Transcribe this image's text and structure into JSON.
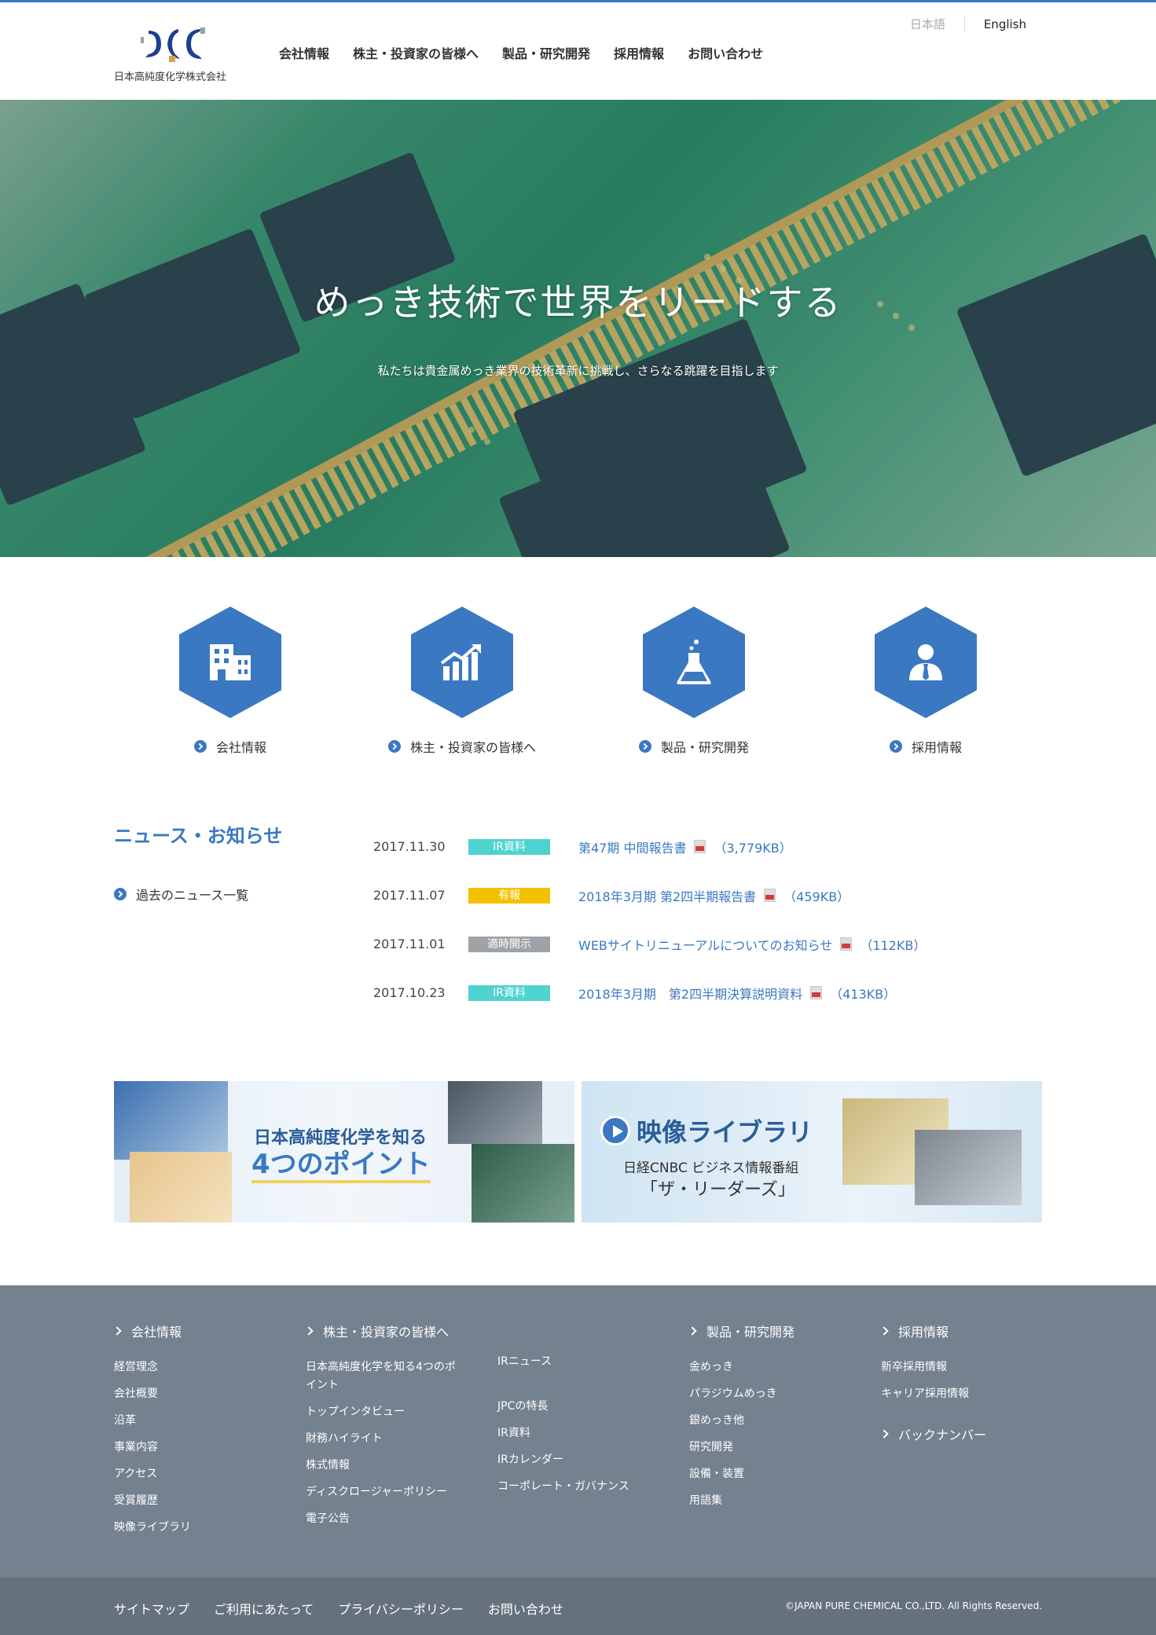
{
  "header": {
    "company_name": "日本高純度化学株式会社",
    "nav": [
      "会社情報",
      "株主・投資家の皆様へ",
      "製品・研究開発",
      "採用情報",
      "お問い合わせ"
    ],
    "lang_ja": "日本語",
    "lang_en": "English"
  },
  "hero": {
    "title": "めっき技術で世界をリードする",
    "subtitle": "私たちは貴金属めっき業界の技術革新に挑戦し、さらなる跳躍を目指します"
  },
  "categories": [
    {
      "label": "会社情報",
      "icon": "building-icon"
    },
    {
      "label": "株主・投資家の皆様へ",
      "icon": "chart-icon"
    },
    {
      "label": "製品・研究開発",
      "icon": "flask-icon"
    },
    {
      "label": "採用情報",
      "icon": "person-icon"
    }
  ],
  "news": {
    "heading": "ニュース・お知らせ",
    "past_link": "過去のニュース一覧",
    "items": [
      {
        "date": "2017.11.30",
        "badge": "IR資料",
        "badge_color": "#4fd3d0",
        "title": "第47期 中間報告書",
        "size": "（3,779KB）"
      },
      {
        "date": "2017.11.07",
        "badge": "有報",
        "badge_color": "#f2c200",
        "title": "2018年3月期 第2四半期報告書",
        "size": "（459KB）"
      },
      {
        "date": "2017.11.01",
        "badge": "適時開示",
        "badge_color": "#9ea3a8",
        "title": "WEBサイトリニューアルについてのお知らせ",
        "size": "（112KB）"
      },
      {
        "date": "2017.10.23",
        "badge": "IR資料",
        "badge_color": "#4fd3d0",
        "title": "2018年3月期　第2四半期決算説明資料",
        "size": "（413KB）"
      }
    ]
  },
  "banners": {
    "b1_line1": "日本高純度化学を知る",
    "b1_line2": "4つのポイント",
    "b2_line1": "映像ライブラリ",
    "b2_line2": "日経CNBC ビジネス情報番組",
    "b2_line3": "「ザ・リーダーズ」"
  },
  "footer": {
    "cols": [
      {
        "heading": "会社情報",
        "items": [
          "経営理念",
          "会社概要",
          "沿革",
          "事業内容",
          "アクセス",
          "受賞履歴",
          "映像ライブラリ"
        ]
      },
      {
        "heading": "株主・投資家の皆様へ",
        "items": [
          "日本高純度化学を知る4つのポ",
          "イント",
          "トップインタビュー",
          "財務ハイライト",
          "株式情報",
          "ディスクロージャーポリシー",
          "電子公告"
        ]
      },
      {
        "heading": "",
        "items": [
          "IRニュース",
          "JPCの特長",
          "IR資料",
          "IRカレンダー",
          "コーポレート・ガバナンス"
        ]
      },
      {
        "heading": "製品・研究開発",
        "items": [
          "金めっき",
          "パラジウムめっき",
          "銀めっき他",
          "研究開発",
          "設備・装置",
          "用語集"
        ]
      },
      {
        "heading": "採用情報",
        "items": [
          "新卒採用情報",
          "キャリア採用情報"
        ]
      }
    ],
    "backnumber": "バックナンバー",
    "bottom_links": [
      "サイトマップ",
      "ご利用にあたって",
      "プライバシーポリシー",
      "お問い合わせ"
    ],
    "copyright": "©JAPAN PURE CHEMICAL CO.,LTD. All Rights Reserved."
  },
  "colors": {
    "accent": "#3a78c2",
    "footer": "#74818e",
    "footer_bottom": "#65717d"
  }
}
